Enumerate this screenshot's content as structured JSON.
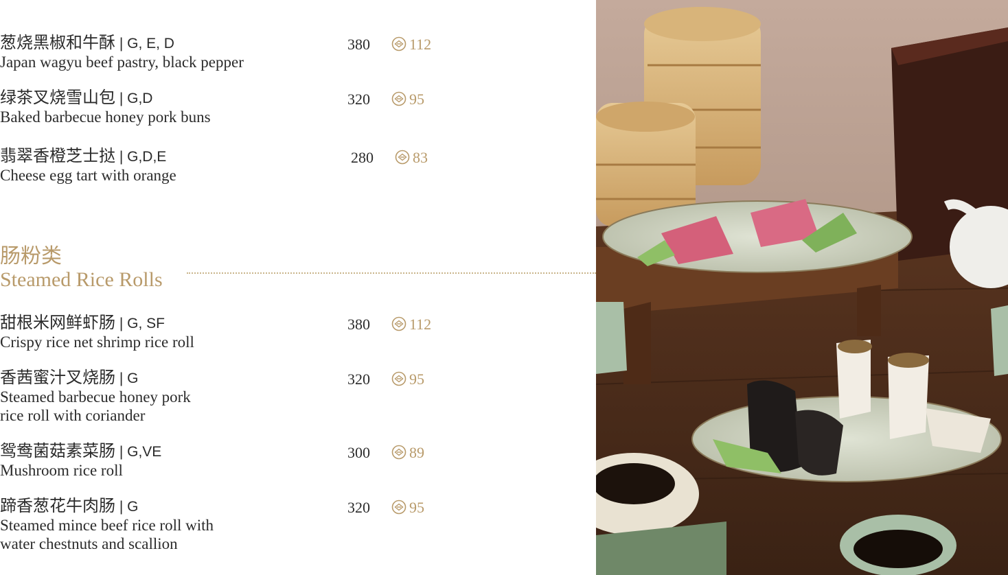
{
  "dim_sum": [
    {
      "zh": "葱烧黑椒和牛酥",
      "codes": " | G, E, D",
      "en": "Japan wagyu beef pastry, black pepper",
      "price": "380",
      "points": "112"
    },
    {
      "zh": "绿茶叉烧雪山包",
      "codes": " | G,D",
      "en": "Baked barbecue honey pork buns",
      "price": "320",
      "points": "95"
    },
    {
      "zh": "翡翠香橙芝士挞",
      "codes": " | G,D,E",
      "en": "Cheese egg tart with orange",
      "price": "280",
      "points": "83"
    }
  ],
  "section": {
    "title_zh": "肠粉类",
    "title_en": "Steamed Rice Rolls"
  },
  "rice_rolls": [
    {
      "zh": "甜根米网鲜虾肠",
      "codes": " | G, SF",
      "en": "Crispy rice net shrimp rice roll",
      "en2": "",
      "price": "380",
      "points": "112"
    },
    {
      "zh": "香茜蜜汁叉烧肠",
      "codes": " | G",
      "en": "Steamed barbecue honey pork",
      "en2": " rice roll with coriander",
      "price": "320",
      "points": "95"
    },
    {
      "zh": "鸳鸯菌菇素菜肠",
      "codes": " | G,VE",
      "en": "Mushroom rice roll",
      "en2": "",
      "price": "300",
      "points": "89"
    },
    {
      "zh": "蹄香葱花牛肉肠",
      "codes": " | G",
      "en": "Steamed mince beef rice roll with",
      "en2": "water chestnuts and scallion",
      "price": "320",
      "points": "95"
    }
  ],
  "colors": {
    "accent": "#b89a6a",
    "text": "#2b2b2b"
  },
  "icons": {
    "points": "points-coin-icon"
  }
}
